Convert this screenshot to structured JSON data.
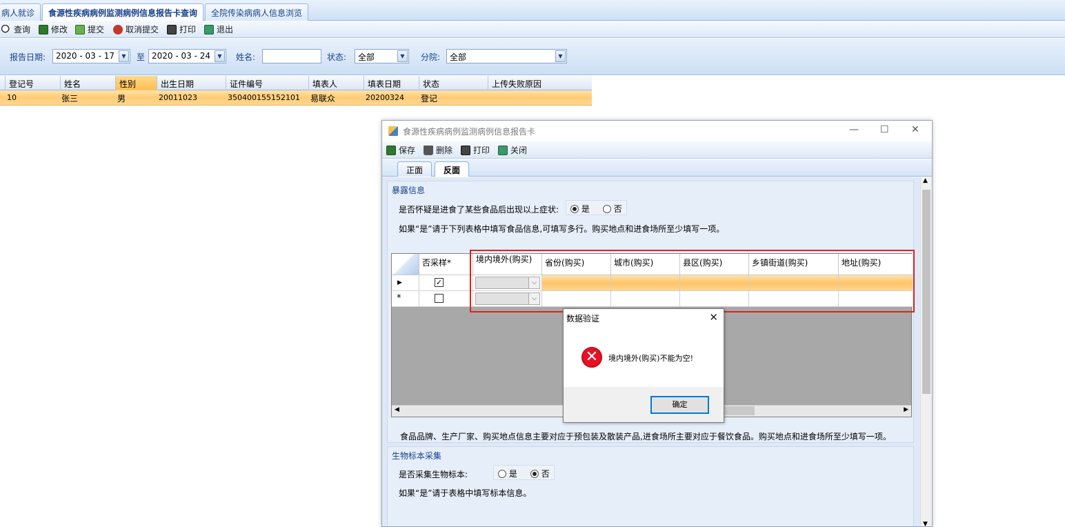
{
  "tabs": [
    "病人就诊",
    "食源性疾病病例监测病例信息报告卡查询",
    "全院传染病病人信息浏览"
  ],
  "toolbar": {
    "query": "查询",
    "edit": "修改",
    "submit": "提交",
    "cancel_submit": "取消提交",
    "print": "打印",
    "exit": "退出"
  },
  "filters": {
    "report_date_label": "报告日期:",
    "date_from": "2020 - 03 - 17",
    "to_label": "至",
    "date_to": "2020 - 03 - 24",
    "name_label": "姓名:",
    "name_value": "",
    "status_label": "状态:",
    "status_value": "全部",
    "branch_label": "分院:",
    "branch_value": "全部"
  },
  "grid": {
    "columns": [
      "登记号",
      "姓名",
      "性别",
      "出生日期",
      "证件编号",
      "填表人",
      "填表日期",
      "状态",
      "上传失败原因"
    ],
    "rows": [
      [
        "10",
        "张三",
        "男",
        "20011023",
        "350400155152101",
        "易联众",
        "20200324",
        "登记",
        ""
      ]
    ]
  },
  "dialog": {
    "title": "食源性疾病病例监测病例信息报告卡",
    "toolbar": {
      "save": "保存",
      "delete": "删除",
      "print": "打印",
      "close": "关闭"
    },
    "tabs": [
      "正面",
      "反面"
    ],
    "exposure": {
      "title": "暴露信息",
      "question": "是否怀疑是进食了某些食品后出现以上症状:",
      "yes": "是",
      "no": "否",
      "hint": "如果“是”请于下列表格中填写食品信息,可填写多行。购买地点和进食场所至少填写一项。",
      "columns": [
        "否采样*",
        "境内境外(购买)",
        "省份(购买)",
        "城市(购买)",
        "县区(购买)",
        "乡镇街道(购买)",
        "地址(购买)"
      ],
      "note": "食品品牌、生产厂家、购买地点信息主要对应于预包装及散装产品,进食场所主要对应于餐饮食品。购买地点和进食场所至少填写一项。"
    },
    "bio": {
      "title": "生物标本采集",
      "question": "是否采集生物标本:",
      "yes": "是",
      "no": "否",
      "hint": "如果“是”请于表格中填写标本信息。"
    }
  },
  "msgbox": {
    "title": "数据验证",
    "text": "境内境外(购买)不能为空!",
    "ok": "确定"
  }
}
